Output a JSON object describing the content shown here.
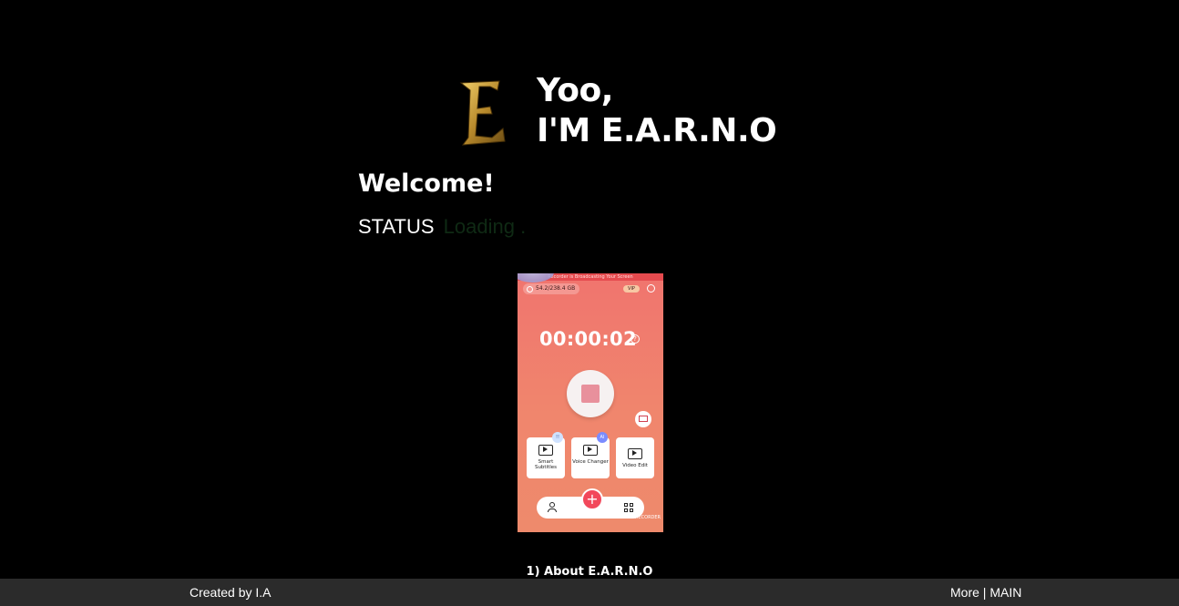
{
  "hero": {
    "line1": "Yoo,",
    "line2": "I'M E.A.R.N.O",
    "logo_letter": "E"
  },
  "welcome": "Welcome!",
  "status": {
    "label": "STATUS",
    "value": "Loading ."
  },
  "phone": {
    "banner": "Recorder is Broadcasting Your Screen",
    "storage": "54.2/238.4 GB",
    "vip": "VIP",
    "timer": "00:00:02",
    "help": "?",
    "tiles": [
      {
        "label": "Smart Subtitles",
        "badge": "!!"
      },
      {
        "label": "Voice Changer",
        "badge": "AI"
      },
      {
        "label": "Video Edit",
        "badge": ""
      }
    ],
    "plus": "+",
    "watermark": "V RECORDER"
  },
  "about": "1) About E.A.R.N.O",
  "footer": {
    "credit": "Created by I.A",
    "more": "More",
    "separator": " | ",
    "main": "MAIN"
  },
  "colors": {
    "background": "#000000",
    "footer": "#2b2b2b",
    "status_value": "#0f2a14",
    "phone_accent": "#f0746e"
  }
}
